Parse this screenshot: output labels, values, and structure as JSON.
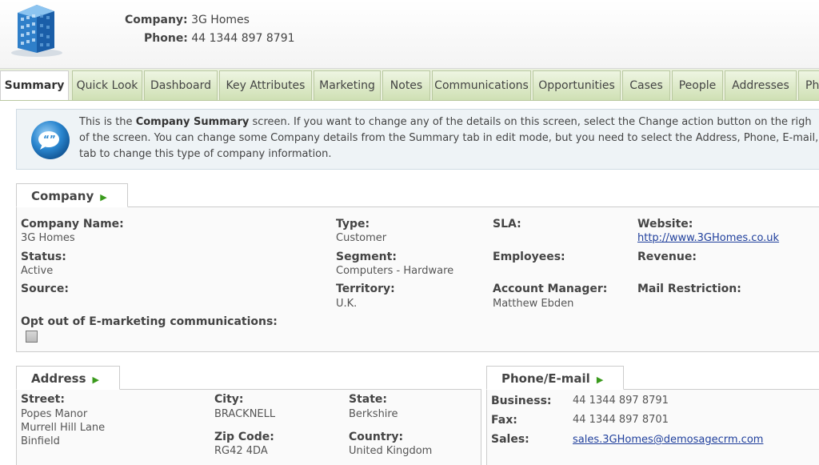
{
  "header": {
    "company_label": "Company:",
    "company_value": "3G Homes",
    "phone_label": "Phone:",
    "phone_value": "44 1344 897 8791"
  },
  "tabs": [
    "Summary",
    "Quick Look",
    "Dashboard",
    "Key Attributes",
    "Marketing",
    "Notes",
    "Communications",
    "Opportunities",
    "Cases",
    "People",
    "Addresses",
    "Ph"
  ],
  "active_tab": "Summary",
  "info": {
    "line1_pre": "This is the ",
    "line1_bold": "Company Summary",
    "line1_post": " screen. If you want to change any of the details on this screen, select the Change action button on the righ",
    "line2": "of the screen. You can change some Company details from the Summary tab in edit mode, but you need to select the Address, Phone, E-mail, o",
    "line3": "tab to change this type of company information."
  },
  "company": {
    "title": "Company",
    "company_name_label": "Company Name:",
    "company_name": "3G Homes",
    "status_label": "Status:",
    "status": "Active",
    "source_label": "Source:",
    "type_label": "Type:",
    "type": "Customer",
    "segment_label": "Segment:",
    "segment": "Computers - Hardware",
    "territory_label": "Territory:",
    "territory": "U.K.",
    "sla_label": "SLA:",
    "employees_label": "Employees:",
    "account_manager_label": "Account Manager:",
    "account_manager": "Matthew Ebden",
    "website_label": "Website:",
    "website": "http://www.3GHomes.co.uk",
    "revenue_label": "Revenue:",
    "mail_restriction_label": "Mail Restriction:",
    "opt_out_label": "Opt out of E-marketing communications:"
  },
  "address": {
    "title": "Address",
    "street_label": "Street:",
    "street_lines": [
      "Popes Manor",
      "Murrell Hill Lane",
      "Binfield"
    ],
    "city_label": "City:",
    "city": "BRACKNELL",
    "zip_label": "Zip Code:",
    "zip": "RG42 4DA",
    "state_label": "State:",
    "state": "Berkshire",
    "country_label": "Country:",
    "country": "United Kingdom"
  },
  "phone_email": {
    "title": "Phone/E-mail",
    "business_label": "Business:",
    "business": "44 1344 897 8791",
    "fax_label": "Fax:",
    "fax": "44 1344 897 8701",
    "sales_label": "Sales:",
    "sales": "sales.3GHomes@demosagecrm.com"
  },
  "colors": {
    "tab_green": "#cfe0b4",
    "link_blue": "#1f3f9c",
    "arrow_green": "#3a9a1c"
  }
}
